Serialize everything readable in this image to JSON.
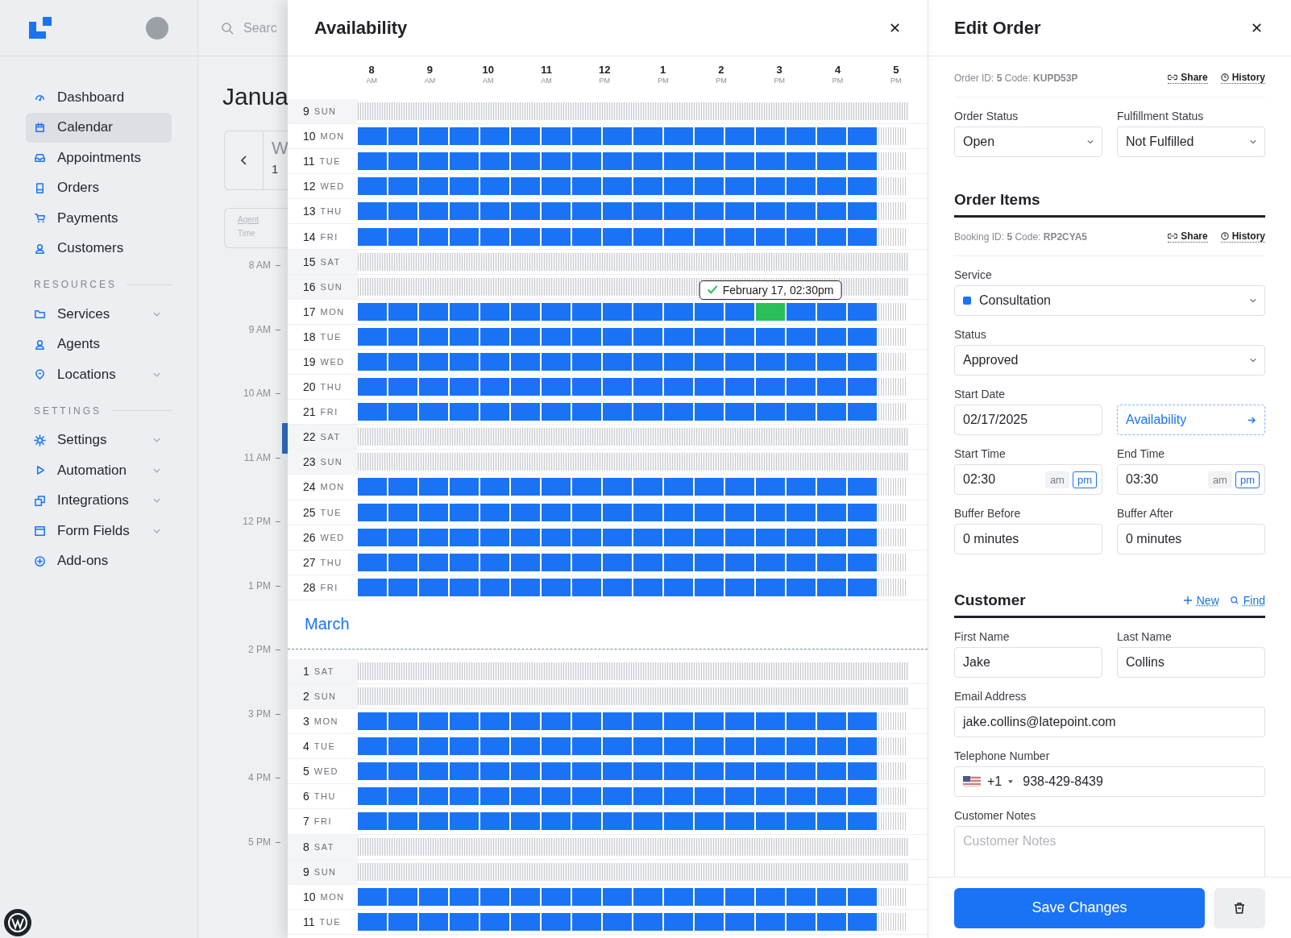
{
  "sidebar": {
    "sections": [
      {
        "items": [
          {
            "label": "Dashboard",
            "selected": false,
            "expandable": false
          },
          {
            "label": "Calendar",
            "selected": true,
            "expandable": false
          },
          {
            "label": "Appointments",
            "selected": false,
            "expandable": false
          },
          {
            "label": "Orders",
            "selected": false,
            "expandable": false
          },
          {
            "label": "Payments",
            "selected": false,
            "expandable": false
          },
          {
            "label": "Customers",
            "selected": false,
            "expandable": false
          }
        ]
      },
      {
        "heading": "RESOURCES",
        "items": [
          {
            "label": "Services",
            "selected": false,
            "expandable": true
          },
          {
            "label": "Agents",
            "selected": false,
            "expandable": false
          },
          {
            "label": "Locations",
            "selected": false,
            "expandable": true
          }
        ]
      },
      {
        "heading": "SETTINGS",
        "items": [
          {
            "label": "Settings",
            "selected": false,
            "expandable": true
          },
          {
            "label": "Automation",
            "selected": false,
            "expandable": true
          },
          {
            "label": "Integrations",
            "selected": false,
            "expandable": true
          },
          {
            "label": "Form Fields",
            "selected": false,
            "expandable": true
          },
          {
            "label": "Add-ons",
            "selected": false,
            "expandable": false
          }
        ]
      }
    ]
  },
  "calendar": {
    "search_placeholder": "Searc",
    "month": "Janua",
    "nav_weekday": "W",
    "nav_day": "1",
    "agent_label": "Agent",
    "time_label": "Time",
    "times": [
      "8 AM",
      "9 AM",
      "10 AM",
      "11 AM",
      "12 PM",
      "1 PM",
      "2 PM",
      "3 PM",
      "4 PM",
      "5 PM"
    ]
  },
  "availability": {
    "title": "Availability",
    "hours": [
      {
        "hour": "8",
        "period": "AM"
      },
      {
        "hour": "9",
        "period": "AM"
      },
      {
        "hour": "10",
        "period": "AM"
      },
      {
        "hour": "11",
        "period": "AM"
      },
      {
        "hour": "12",
        "period": "PM"
      },
      {
        "hour": "1",
        "period": "PM"
      },
      {
        "hour": "2",
        "period": "PM"
      },
      {
        "hour": "3",
        "period": "PM"
      },
      {
        "hour": "4",
        "period": "PM"
      },
      {
        "hour": "5",
        "period": "PM"
      }
    ],
    "slot_columns": [
      {
        "selected": false
      },
      {
        "selected": false
      },
      {
        "selected": false
      },
      {
        "selected": false
      },
      {
        "selected": false
      },
      {
        "selected": false
      },
      {
        "selected": false
      },
      {
        "selected": false
      },
      {
        "selected": false
      },
      {
        "selected": false
      },
      {
        "selected": false
      },
      {
        "selected": false
      },
      {
        "selected": false
      },
      {
        "selected": true
      },
      {
        "selected": false
      },
      {
        "selected": false
      },
      {
        "selected": false
      }
    ],
    "tooltip": "February 17, 02:30pm",
    "groups": [
      {
        "days": [
          {
            "date": "9",
            "weekday": "SUN",
            "kind": "closed",
            "selected": false
          },
          {
            "date": "10",
            "weekday": "MON",
            "kind": "open",
            "selected": false
          },
          {
            "date": "11",
            "weekday": "TUE",
            "kind": "open",
            "selected": false
          },
          {
            "date": "12",
            "weekday": "WED",
            "kind": "open",
            "selected": false
          },
          {
            "date": "13",
            "weekday": "THU",
            "kind": "open",
            "selected": false
          },
          {
            "date": "14",
            "weekday": "FRI",
            "kind": "open",
            "selected": false
          },
          {
            "date": "15",
            "weekday": "SAT",
            "kind": "closed",
            "selected": false
          },
          {
            "date": "16",
            "weekday": "SUN",
            "kind": "closed",
            "selected": false
          },
          {
            "date": "17",
            "weekday": "MON",
            "kind": "open",
            "selected": true
          },
          {
            "date": "18",
            "weekday": "TUE",
            "kind": "open",
            "selected": false
          },
          {
            "date": "19",
            "weekday": "WED",
            "kind": "open",
            "selected": false
          },
          {
            "date": "20",
            "weekday": "THU",
            "kind": "open",
            "selected": false
          },
          {
            "date": "21",
            "weekday": "FRI",
            "kind": "open",
            "selected": false
          },
          {
            "date": "22",
            "weekday": "SAT",
            "kind": "closed",
            "selected": false
          },
          {
            "date": "23",
            "weekday": "SUN",
            "kind": "closed",
            "selected": false
          },
          {
            "date": "24",
            "weekday": "MON",
            "kind": "open",
            "selected": false
          },
          {
            "date": "25",
            "weekday": "TUE",
            "kind": "open",
            "selected": false
          },
          {
            "date": "26",
            "weekday": "WED",
            "kind": "open",
            "selected": false
          },
          {
            "date": "27",
            "weekday": "THU",
            "kind": "open",
            "selected": false
          },
          {
            "date": "28",
            "weekday": "FRI",
            "kind": "open",
            "selected": false
          }
        ]
      },
      {
        "month": "March",
        "days": [
          {
            "date": "1",
            "weekday": "SAT",
            "kind": "closed",
            "selected": false
          },
          {
            "date": "2",
            "weekday": "SUN",
            "kind": "closed",
            "selected": false
          },
          {
            "date": "3",
            "weekday": "MON",
            "kind": "open",
            "selected": false
          },
          {
            "date": "4",
            "weekday": "TUE",
            "kind": "open",
            "selected": false
          },
          {
            "date": "5",
            "weekday": "WED",
            "kind": "open",
            "selected": false
          },
          {
            "date": "6",
            "weekday": "THU",
            "kind": "open",
            "selected": false
          },
          {
            "date": "7",
            "weekday": "FRI",
            "kind": "open",
            "selected": false
          },
          {
            "date": "8",
            "weekday": "SAT",
            "kind": "closed",
            "selected": false
          },
          {
            "date": "9",
            "weekday": "SUN",
            "kind": "closed",
            "selected": false
          },
          {
            "date": "10",
            "weekday": "MON",
            "kind": "open",
            "selected": false
          },
          {
            "date": "11",
            "weekday": "TUE",
            "kind": "open",
            "selected": false
          }
        ]
      }
    ]
  },
  "edit_order": {
    "title": "Edit Order",
    "order_meta": "Order ID: **5**  Code: **KUPD53P**",
    "share": "Share",
    "history": "History",
    "order_status": {
      "label": "Order Status",
      "value": "Open"
    },
    "fulfillment_status": {
      "label": "Fulfillment Status",
      "value": "Not Fulfilled"
    },
    "items_heading": "Order Items",
    "booking_meta": "Booking ID: **5**  Code: **RP2CYA5**",
    "booking_share": "Share",
    "booking_history": "History",
    "service": {
      "label": "Service",
      "value": "Consultation",
      "color": "#1a73f5"
    },
    "status": {
      "label": "Status",
      "value": "Approved"
    },
    "start_date": {
      "label": "Start Date",
      "value": "02/17/2025"
    },
    "availability_button": "Availability",
    "start_time": {
      "label": "Start Time",
      "value": "02:30",
      "periods": [
        {
          "label": "am",
          "selected": false
        },
        {
          "label": "pm",
          "selected": true
        }
      ]
    },
    "end_time": {
      "label": "End Time",
      "value": "03:30",
      "periods": [
        {
          "label": "am",
          "selected": false
        },
        {
          "label": "pm",
          "selected": true
        }
      ]
    },
    "buffer_before": {
      "label": "Buffer Before",
      "value": "0 minutes"
    },
    "buffer_after": {
      "label": "Buffer After",
      "value": "0 minutes"
    },
    "customer_heading": "Customer",
    "new_link": "New",
    "find_link": "Find",
    "first_name": {
      "label": "First Name",
      "value": "Jake"
    },
    "last_name": {
      "label": "Last Name",
      "value": "Collins"
    },
    "email": {
      "label": "Email Address",
      "value": "jake.collins@latepoint.com"
    },
    "telephone": {
      "label": "Telephone Number",
      "country_code": "+1",
      "value": "938-429-8439"
    },
    "notes": {
      "label": "Customer Notes",
      "placeholder": "Customer Notes"
    },
    "save_button": "Save Changes"
  }
}
